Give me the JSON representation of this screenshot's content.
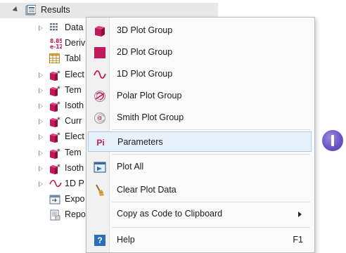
{
  "tree": {
    "root_label": "Results",
    "children": [
      {
        "label": "Data",
        "icon": "dataset-icon",
        "expandable": true
      },
      {
        "label": "Deriv",
        "icon": "derived-values-icon",
        "expandable": false
      },
      {
        "label": "Tabl",
        "icon": "table-icon",
        "expandable": false
      },
      {
        "label": "Elect",
        "icon": "plot-group-icon",
        "expandable": true
      },
      {
        "label": "Tem",
        "icon": "plot-group-icon",
        "expandable": true
      },
      {
        "label": "Isoth",
        "icon": "plot-group-icon",
        "expandable": true
      },
      {
        "label": "Curr",
        "icon": "plot-group-icon",
        "expandable": true
      },
      {
        "label": "Elect",
        "icon": "plot-group-icon",
        "expandable": true
      },
      {
        "label": "Tem",
        "icon": "plot-group-icon",
        "expandable": true
      },
      {
        "label": "Isoth",
        "icon": "plot-group-icon",
        "expandable": true
      },
      {
        "label": "1D P",
        "icon": "1d-plot-icon",
        "expandable": true
      },
      {
        "label": "Expo",
        "icon": "export-icon",
        "expandable": false
      },
      {
        "label": "Repo",
        "icon": "report-icon",
        "expandable": false
      }
    ],
    "derived_icon_text_top": "8.85",
    "derived_icon_text_bottom": "e-12"
  },
  "context_menu": {
    "items": [
      {
        "label": "3D Plot Group",
        "icon": "3d-plot-group-icon"
      },
      {
        "label": "2D Plot Group",
        "icon": "2d-plot-group-icon"
      },
      {
        "label": "1D Plot Group",
        "icon": "1d-plot-group-icon"
      },
      {
        "label": "Polar Plot Group",
        "icon": "polar-plot-group-icon"
      },
      {
        "label": "Smith Plot Group",
        "icon": "smith-plot-group-icon"
      },
      {
        "label": "Parameters",
        "icon": "parameters-icon",
        "icon_text": "Pi",
        "highlighted": true
      },
      {
        "label": "Plot All",
        "icon": "plot-all-icon"
      },
      {
        "label": "Clear Plot Data",
        "icon": "clear-plot-data-icon"
      },
      {
        "label": "Copy as Code to Clipboard",
        "icon": "",
        "has_submenu": true
      },
      {
        "label": "Help",
        "icon": "help-icon",
        "icon_text": "?",
        "shortcut": "F1"
      }
    ]
  },
  "colors": {
    "plot_group": "#c2185b",
    "highlight_bg": "#e6f1fb",
    "highlight_border": "#a9cdee",
    "help_blue": "#2a6fb8",
    "cursor": "#6b54c8"
  }
}
